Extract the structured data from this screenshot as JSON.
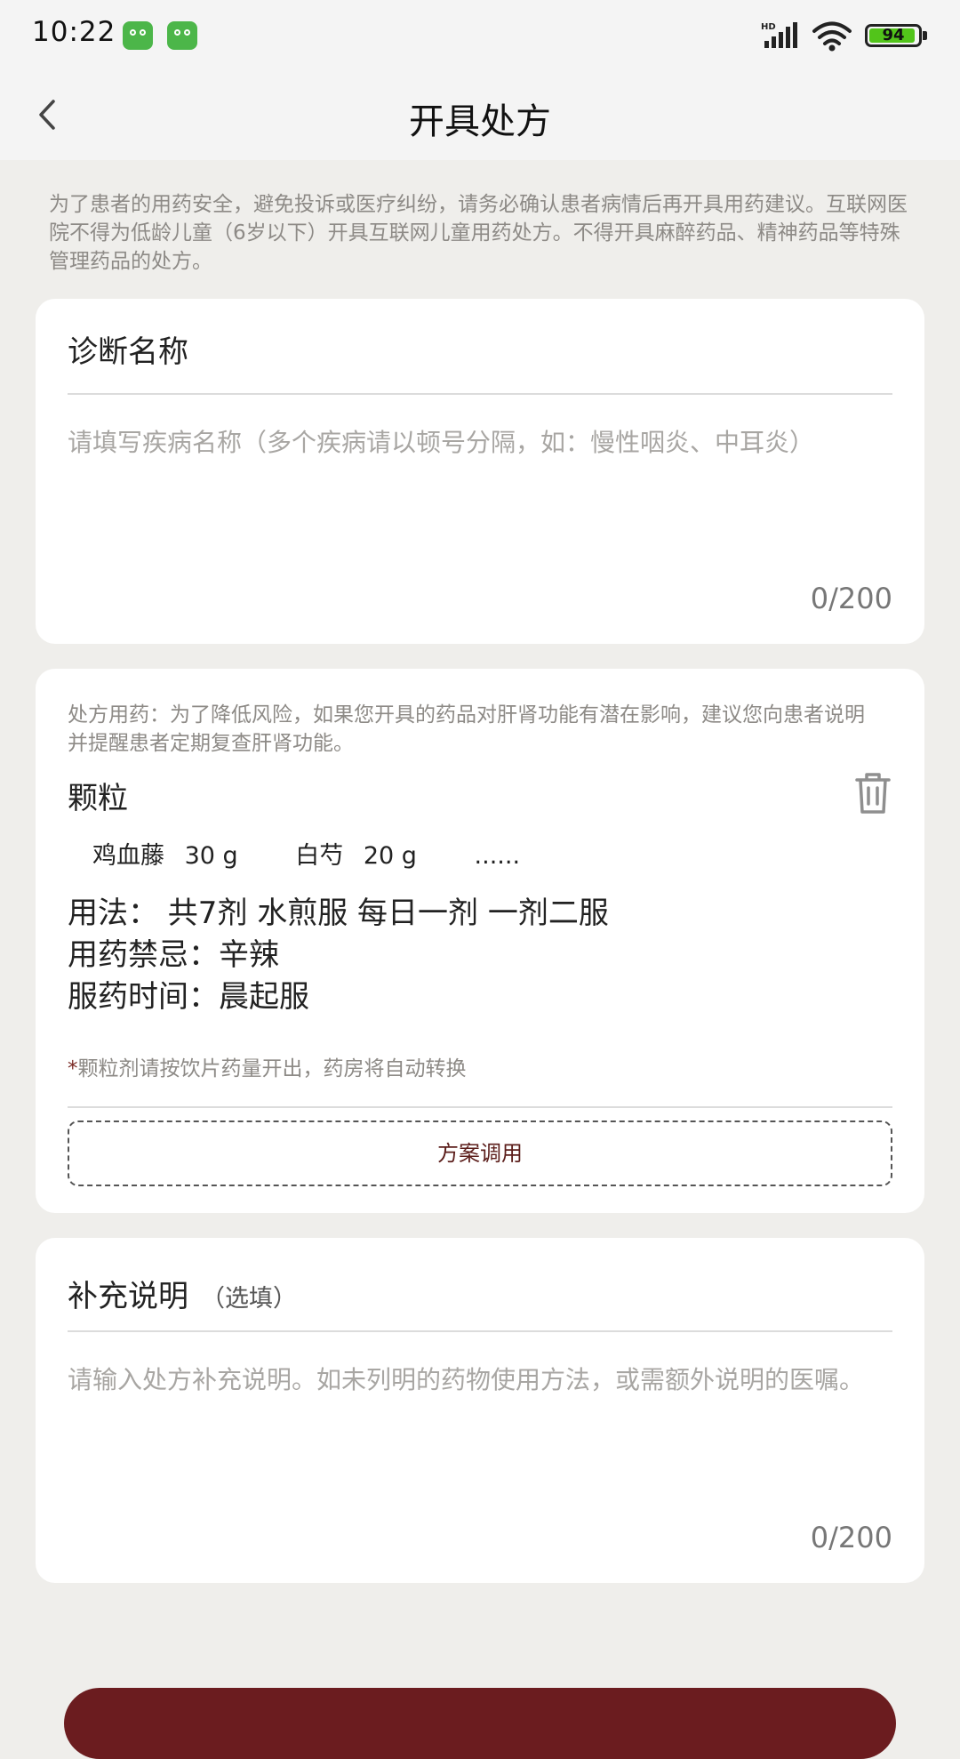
{
  "status_bar": {
    "time": "10:22",
    "network": "HD",
    "battery": "94",
    "battery_level": 0.94,
    "app_icon_color": "#4cb649"
  },
  "nav": {
    "title": "开具处方",
    "back_icon": "chevron-left-icon"
  },
  "notice": "为了患者的用药安全，避免投诉或医疗纠纷，请务必确认患者病情后再开具用药建议。互联网医院不得为低龄儿童（6岁以下）开具互联网儿童用药处方。不得开具麻醉药品、精神药品等特殊管理药品的处方。",
  "diagnosis": {
    "title": "诊断名称",
    "placeholder": "请填写疾病名称（多个疾病请以顿号分隔，如：慢性咽炎、中耳炎）",
    "counter": "0/200"
  },
  "prescription": {
    "notice": "处方用药：为了降低风险，如果您开具的药品对肝肾功能有潜在影响，建议您向患者说明并提醒患者定期复查肝肾功能。",
    "type": "颗粒",
    "herbs": [
      {
        "name": "鸡血藤",
        "dose": "30 g"
      },
      {
        "name": "白芍",
        "dose": "20 g"
      }
    ],
    "more": "......",
    "usage": "用法：  共7剂 水煎服 每日一剂 一剂二服",
    "contraindication": "用药禁忌：辛辣",
    "timing": "服药时间：晨起服",
    "tip_star": "*",
    "tip": "颗粒剂请按饮片药量开出，药房将自动转换",
    "plan_button": "方案调用"
  },
  "supplement": {
    "title": "补充说明",
    "optional": "（选填）",
    "placeholder": "请输入处方补充说明。如未列明的药物使用方法，或需额外说明的医嘱。",
    "counter": "0/200"
  },
  "colors": {
    "brand": "#6b1c1f",
    "background": "#efeeeb",
    "hint_text": "#8d8a86"
  }
}
